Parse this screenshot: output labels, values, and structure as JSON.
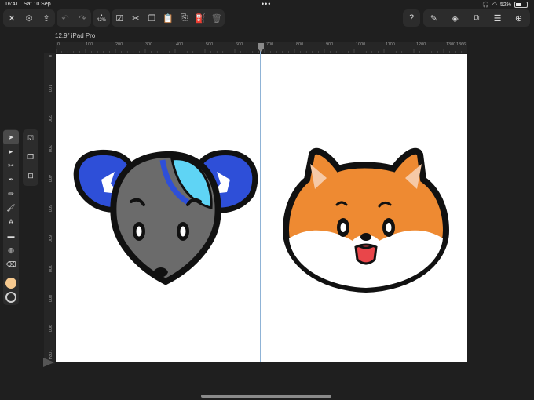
{
  "status": {
    "time": "16:41",
    "date": "Sat 10 Sep",
    "dots": "•••",
    "battery": "52%"
  },
  "toolbar": {
    "zoom_label": "42%",
    "help_label": "?"
  },
  "document": {
    "title": "12.9\" iPad Pro"
  },
  "ruler_h": [
    "0",
    "100",
    "200",
    "300",
    "400",
    "500",
    "600",
    "700",
    "800",
    "900",
    "1000",
    "1100",
    "1200",
    "1300",
    "1366"
  ],
  "ruler_v": [
    "0",
    "100",
    "200",
    "300",
    "400",
    "500",
    "600",
    "700",
    "800",
    "900",
    "1024"
  ],
  "colors": {
    "fill": "#f6c98f",
    "stroke": "#1c1c1c",
    "canvas": "#ffffff",
    "guide": "#8fb3d6"
  }
}
